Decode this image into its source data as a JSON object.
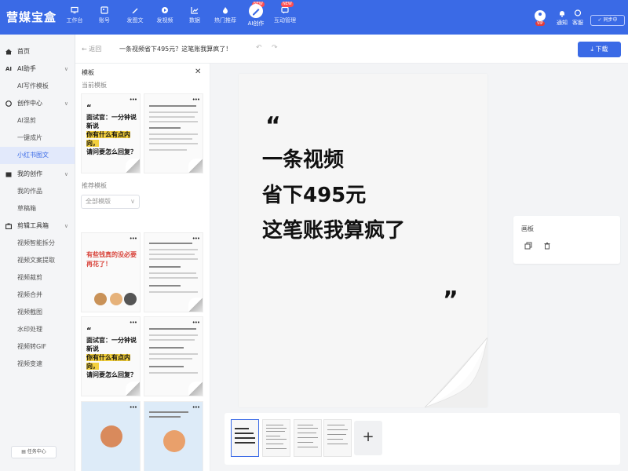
{
  "app": {
    "title": "营媒宝盒",
    "brand_color": "#3a6ae6"
  },
  "topnav": {
    "items": [
      {
        "label": "工作台",
        "icon": "monitor-icon"
      },
      {
        "label": "账号",
        "icon": "image-icon"
      },
      {
        "label": "发图文",
        "icon": "pen-icon"
      },
      {
        "label": "发视频",
        "icon": "play-icon"
      },
      {
        "label": "数据",
        "icon": "chart-icon"
      },
      {
        "label": "热门推荐",
        "icon": "fire-icon"
      },
      {
        "label": "AI创作",
        "icon": "ai-pen-icon",
        "badge": "NEW"
      },
      {
        "label": "互动管理",
        "icon": "chat-icon",
        "badge": "NEW"
      }
    ],
    "vip_badge": "VIP",
    "notify_label": "通知",
    "message_label": "客服",
    "sync_label": "同步中"
  },
  "sidebar": {
    "items": [
      {
        "label": "首页",
        "type": "head",
        "icon": "home-icon"
      },
      {
        "label": "AI助手",
        "type": "head",
        "icon": "ai-icon",
        "caret": "∨"
      },
      {
        "label": "AI写作模板",
        "type": "sub"
      },
      {
        "label": "创作中心",
        "type": "head",
        "icon": "create-icon",
        "caret": "∨"
      },
      {
        "label": "AI混剪",
        "type": "sub"
      },
      {
        "label": "一键成片",
        "type": "sub"
      },
      {
        "label": "小红书图文",
        "type": "sub",
        "active": true
      },
      {
        "label": "我的创作",
        "type": "head",
        "icon": "folder-icon",
        "caret": "∨"
      },
      {
        "label": "我的作品",
        "type": "sub"
      },
      {
        "label": "草稿箱",
        "type": "sub"
      },
      {
        "label": "剪辑工具箱",
        "type": "head",
        "icon": "toolbox-icon",
        "caret": "∨"
      },
      {
        "label": "视频智能拆分",
        "type": "sub"
      },
      {
        "label": "视频文案提取",
        "type": "sub"
      },
      {
        "label": "视频裁剪",
        "type": "sub"
      },
      {
        "label": "视频合并",
        "type": "sub"
      },
      {
        "label": "视频截图",
        "type": "sub"
      },
      {
        "label": "水印处理",
        "type": "sub"
      },
      {
        "label": "视频转GIF",
        "type": "sub"
      },
      {
        "label": "视频变速",
        "type": "sub"
      }
    ],
    "task_center": "任务中心"
  },
  "header": {
    "back_label": "返回",
    "doc_title": "一条视频省下495元？这笔账我算疯了！",
    "download_label": "下载"
  },
  "templates": {
    "title": "模板",
    "current_label": "当前模板",
    "recommended_label": "推荐模板",
    "filter_value": "全部模版",
    "card_text_1": [
      "面试官：一分钟说",
      "新说",
      "你有什么有点内向，",
      "请问要怎么回复？"
    ],
    "card_pink": "有些钱真的没必要再花了！"
  },
  "canvas": {
    "quote_open": "“",
    "lines": [
      "一条视频",
      "省下495元",
      "这笔账我算疯了"
    ],
    "quote_close": "”"
  },
  "right_panel": {
    "label": "画板"
  },
  "thumbs": {
    "add_label": "+"
  }
}
